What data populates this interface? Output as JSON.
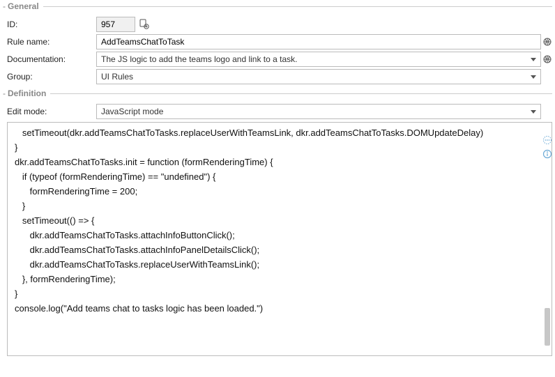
{
  "general": {
    "legend": "General",
    "id_label": "ID:",
    "id_value": "957",
    "rule_label": "Rule name:",
    "rule_value": "AddTeamsChatToTask",
    "doc_label": "Documentation:",
    "doc_value": "The JS logic to add the teams logo and link to a task.",
    "group_label": "Group:",
    "group_value": "UI Rules"
  },
  "definition": {
    "legend": "Definition",
    "mode_label": "Edit mode:",
    "mode_value": "JavaScript mode",
    "code_lines": [
      "   setTimeout(dkr.addTeamsChatToTasks.replaceUserWithTeamsLink, dkr.addTeamsChatToTasks.DOMUpdateDelay)",
      "}",
      "",
      "dkr.addTeamsChatToTasks.init = function (formRenderingTime) {",
      "   if (typeof (formRenderingTime) == \"undefined\") {",
      "      formRenderingTime = 200;",
      "   }",
      "",
      "   setTimeout(() => {",
      "      dkr.addTeamsChatToTasks.attachInfoButtonClick();",
      "      dkr.addTeamsChatToTasks.attachInfoPanelDetailsClick();",
      "      dkr.addTeamsChatToTasks.replaceUserWithTeamsLink();",
      "   }, formRenderingTime);",
      "",
      "}",
      "",
      "console.log(\"Add teams chat to tasks logic has been loaded.\")"
    ]
  }
}
